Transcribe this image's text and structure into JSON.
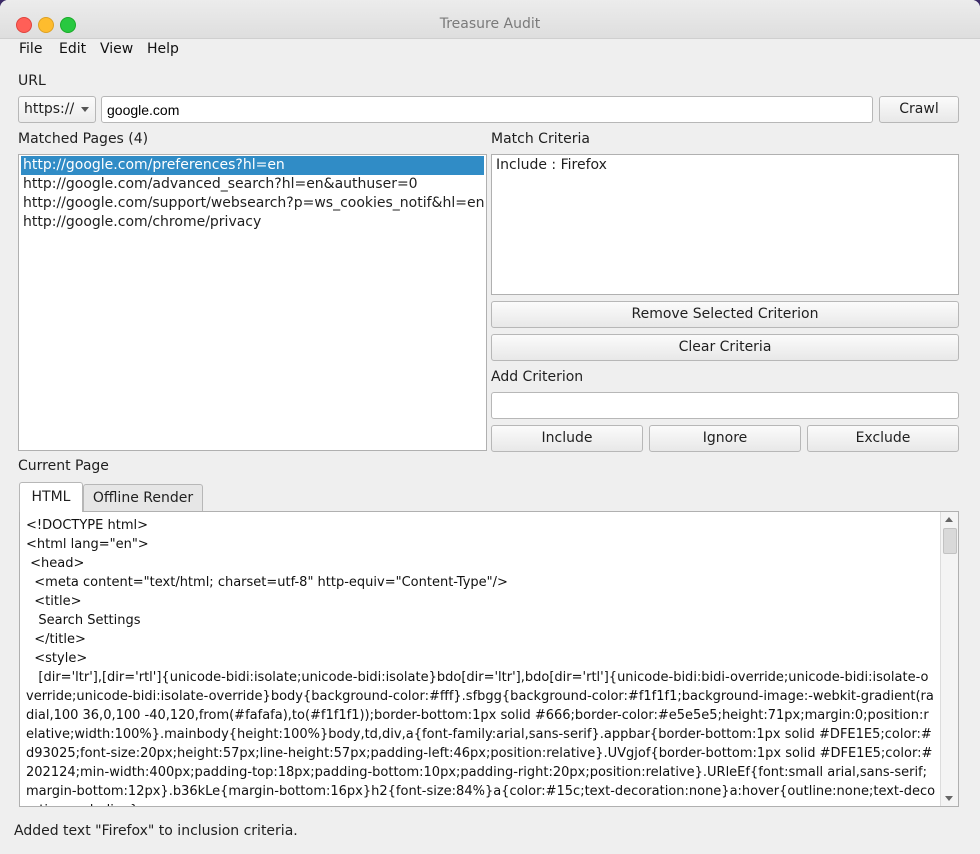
{
  "window": {
    "title": "Treasure Audit"
  },
  "menu": [
    "File",
    "Edit",
    "View",
    "Help"
  ],
  "url": {
    "label": "URL",
    "scheme": "https://",
    "value": "google.com",
    "crawl_label": "Crawl"
  },
  "matched": {
    "label": "Matched Pages (4)",
    "items": [
      "http://google.com/preferences?hl=en",
      "http://google.com/advanced_search?hl=en&authuser=0",
      "http://google.com/support/websearch?p=ws_cookies_notif&hl=en",
      "http://google.com/chrome/privacy"
    ],
    "selected_index": 0
  },
  "criteria": {
    "label": "Match Criteria",
    "items": [
      "Include : Firefox"
    ],
    "remove_label": "Remove Selected Criterion",
    "clear_label": "Clear Criteria",
    "add_label": "Add Criterion",
    "add_value": "",
    "include_label": "Include",
    "ignore_label": "Ignore",
    "exclude_label": "Exclude"
  },
  "current_page": {
    "label": "Current Page",
    "tabs": [
      "HTML",
      "Offline Render"
    ],
    "active_tab": "HTML",
    "source": "<!DOCTYPE html>\n<html lang=\"en\">\n <head>\n  <meta content=\"text/html; charset=utf-8\" http-equiv=\"Content-Type\"/>\n  <title>\n   Search Settings\n  </title>\n  <style>\n   [dir='ltr'],[dir='rtl']{unicode-bidi:isolate;unicode-bidi:isolate}bdo[dir='ltr'],bdo[dir='rtl']{unicode-bidi:bidi-override;unicode-bidi:isolate-override;unicode-bidi:isolate-override}body{background-color:#fff}.sfbgg{background-color:#f1f1f1;background-image:-webkit-gradient(radial,100 36,0,100 -40,120,from(#fafafa),to(#f1f1f1));border-bottom:1px solid #666;border-color:#e5e5e5;height:71px;margin:0;position:relative;width:100%}.mainbody{height:100%}body,td,div,a{font-family:arial,sans-serif}.appbar{border-bottom:1px solid #DFE1E5;color:#d93025;font-size:20px;height:57px;line-height:57px;padding-left:46px;position:relative}.UVgjof{border-bottom:1px solid #DFE1E5;color:#202124;min-width:400px;padding-top:18px;padding-bottom:10px;padding-right:20px;position:relative}.URleEf{font:small arial,sans-serif;margin-bottom:12px}.b36kLe{margin-bottom:16px}h2{font-size:84%}a{color:#15c;text-decoration:none}a:hover{outline:none;text-decoration:underline}"
  },
  "status": "Added text \"Firefox\" to inclusion criteria."
}
